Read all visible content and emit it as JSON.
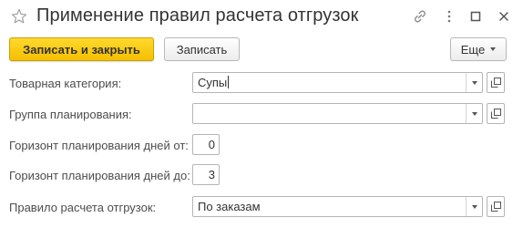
{
  "window": {
    "title": "Применение правил расчета отгрузок",
    "icons": [
      "star-icon",
      "link-icon",
      "more-vertical-icon",
      "maximize-icon",
      "close-icon"
    ]
  },
  "toolbar": {
    "save_close_label": "Записать и закрыть",
    "save_label": "Записать",
    "more_label": "Еще"
  },
  "form": {
    "product_category": {
      "label": "Товарная категория:",
      "value": "Супы"
    },
    "planning_group": {
      "label": "Группа планирования:",
      "value": ""
    },
    "horizon_from": {
      "label": "Горизонт планирования дней от:",
      "value": "0"
    },
    "horizon_to": {
      "label": "Горизонт планирования дней до:",
      "value": "3"
    },
    "shipment_rule": {
      "label": "Правило расчета отгрузок:",
      "value": "По заказам"
    }
  },
  "colors": {
    "primary_button": "#f5bf00",
    "border": "#b5b5b5",
    "text": "#333333"
  }
}
